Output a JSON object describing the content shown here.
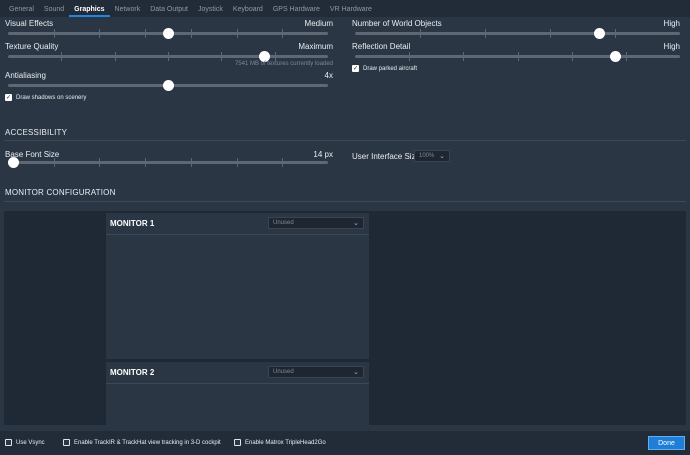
{
  "tabs": [
    "General",
    "Sound",
    "Graphics",
    "Network",
    "Data Output",
    "Joystick",
    "Keyboard",
    "GPS Hardware",
    "VR Hardware"
  ],
  "active_tab": "Graphics",
  "graphics": {
    "visual_effects": {
      "label": "Visual Effects",
      "value": "Medium",
      "level": 0.5
    },
    "texture_quality": {
      "label": "Texture Quality",
      "value": "Maximum",
      "level": 0.8,
      "note": "7541 MB of textures currently loaded"
    },
    "antialiasing": {
      "label": "Antialiasing",
      "value": "4x",
      "level": 0.5
    },
    "draw_shadows": {
      "label": "Draw shadows on scenery",
      "checked": true
    },
    "world_objects": {
      "label": "Number of World Objects",
      "value": "High",
      "level": 0.75
    },
    "reflection_detail": {
      "label": "Reflection Detail",
      "value": "High",
      "level": 0.8
    },
    "draw_parked": {
      "label": "Draw parked aircraft",
      "checked": true
    }
  },
  "accessibility": {
    "title": "ACCESSIBILITY",
    "base_font": {
      "label": "Base Font Size",
      "value": "14 px",
      "level": 0.0
    },
    "ui_size": {
      "label": "User Interface Size",
      "value": "100%"
    }
  },
  "monitor_config": {
    "title": "MONITOR CONFIGURATION",
    "monitors": [
      {
        "title": "MONITOR 1",
        "select": "Unused"
      },
      {
        "title": "MONITOR 2",
        "select": "Unused"
      }
    ]
  },
  "footer": {
    "use_vsync": "Use Vsync",
    "trackir": "Enable TrackIR & TrackHat view tracking in 3-D cockpit",
    "matrox": "Enable Matrox TripleHead2Go",
    "done": "Done"
  },
  "colors": {
    "accent": "#1f7fd8",
    "background": "#2b3644",
    "panel": "#1f2935"
  }
}
